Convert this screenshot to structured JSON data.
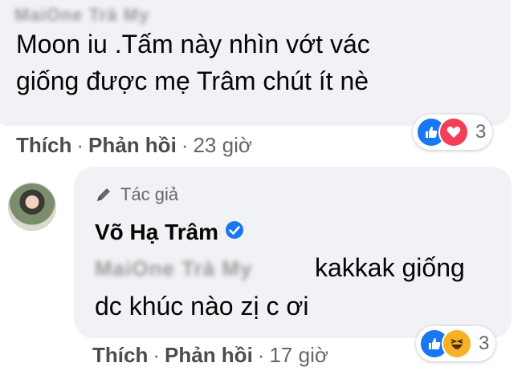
{
  "comment1": {
    "author": "MaiOne Trà My",
    "text_line1": "Moon iu .Tấm này nhìn vớt vác",
    "text_line2": "giống được mẹ Trâm chút ít nè",
    "actions": {
      "like": "Thích",
      "sep1": "·",
      "reply": "Phản hồi",
      "sep2": "·",
      "time": "23 giờ"
    },
    "reactions": {
      "icons": [
        "like-icon",
        "love-icon"
      ],
      "count": "3"
    }
  },
  "comment2": {
    "badge": "Tác giả",
    "author": "Võ Hạ Trâm",
    "mention": "MaiOne Trà My",
    "text_line1": "kakkak giống",
    "text_line2": "dc khúc nào zị c ơi",
    "actions": {
      "like": "Thích",
      "sep1": "·",
      "reply": "Phản hồi",
      "sep2": "·",
      "time": "17 giờ"
    },
    "reactions": {
      "icons": [
        "like-icon",
        "haha-icon"
      ],
      "count": "3"
    }
  },
  "colors": {
    "bubble": "#f0f2f5",
    "like_blue": "#1877f2",
    "love_red": "#f33e58",
    "haha_yellow": "#f7b125",
    "meta_gray": "#65676b"
  }
}
